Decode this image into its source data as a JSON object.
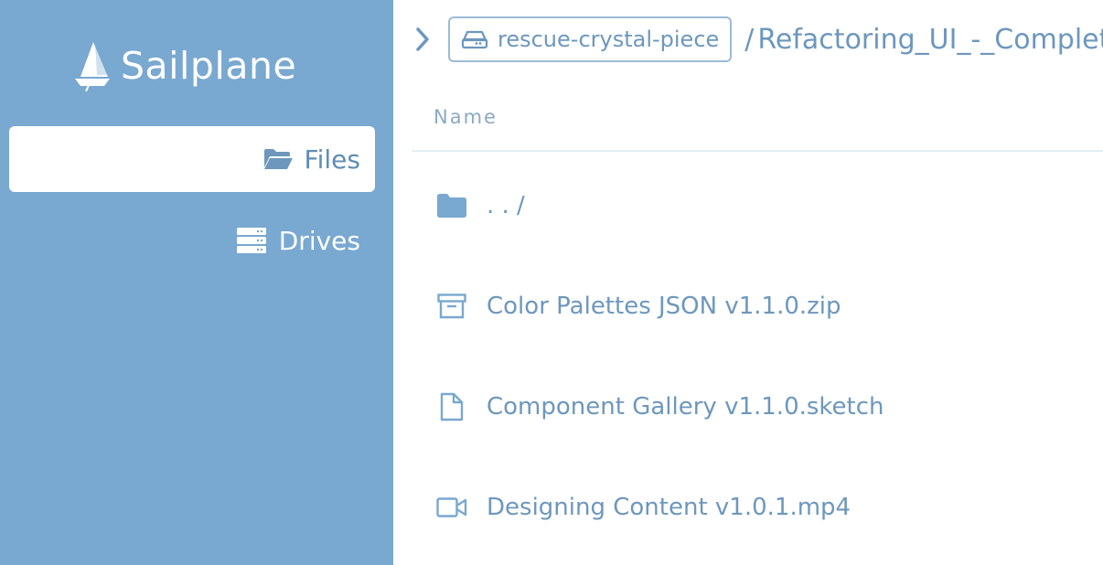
{
  "brand": {
    "name": "Sailplane"
  },
  "sidebar": {
    "items": [
      {
        "label": "Files",
        "icon": "folder-open-icon",
        "active": true
      },
      {
        "label": "Drives",
        "icon": "server-icon",
        "active": false
      }
    ]
  },
  "breadcrumb": {
    "drive": "rescue-crystal-piece",
    "separator": "/",
    "path": "Refactoring_UI_-_Complete"
  },
  "table": {
    "column_header": "Name",
    "rows": [
      {
        "name": ". . /",
        "icon": "folder-icon"
      },
      {
        "name": "Color Palettes JSON v1.1.0.zip",
        "icon": "archive-icon"
      },
      {
        "name": "Component Gallery v1.1.0.sketch",
        "icon": "file-icon"
      },
      {
        "name": "Designing Content v1.0.1.mp4",
        "icon": "video-icon"
      }
    ]
  },
  "colors": {
    "sidebar_bg": "#79a8d0",
    "accent": "#6d97bd",
    "icon": "#79a8d0"
  }
}
